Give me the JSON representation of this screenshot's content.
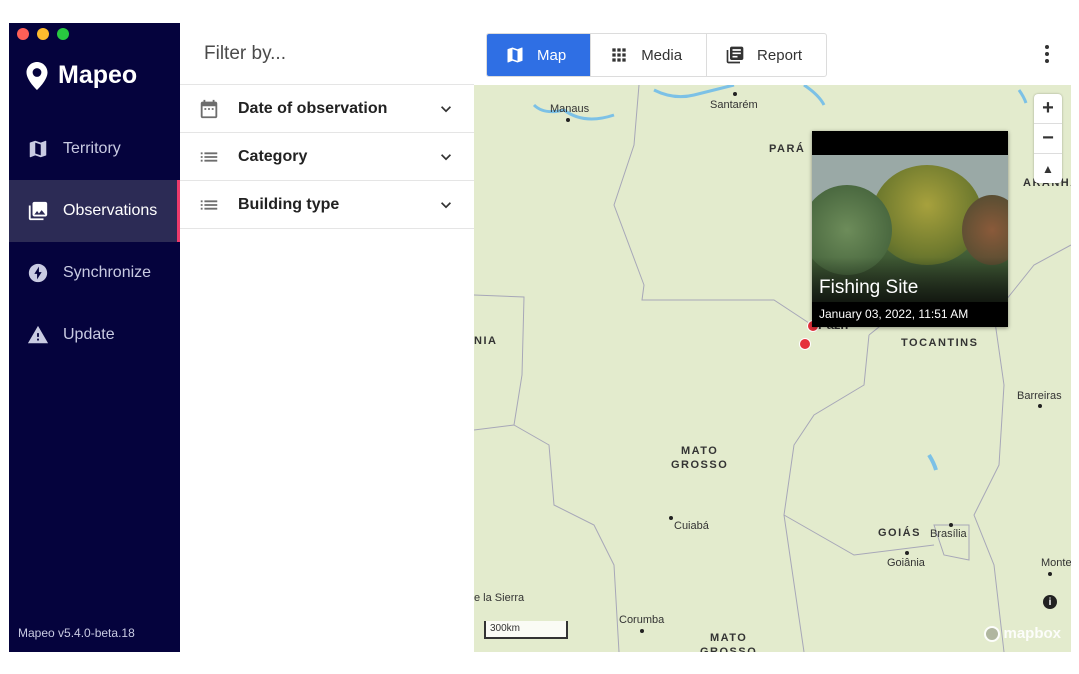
{
  "sidebar": {
    "app_name": "Mapeo",
    "items": [
      {
        "label": "Territory",
        "icon": "map-icon"
      },
      {
        "label": "Observations",
        "icon": "photo-library-icon"
      },
      {
        "label": "Synchronize",
        "icon": "bolt-icon"
      },
      {
        "label": "Update",
        "icon": "warning-icon"
      }
    ],
    "active_index": 1,
    "version": "Mapeo v5.4.0-beta.18"
  },
  "filters": {
    "title": "Filter by...",
    "items": [
      {
        "label": "Date of observation",
        "icon": "calendar-icon"
      },
      {
        "label": "Category",
        "icon": "list-icon"
      },
      {
        "label": "Building type",
        "icon": "list-icon"
      }
    ]
  },
  "toolbar": {
    "tabs": [
      {
        "label": "Map",
        "icon": "map-icon",
        "active": true
      },
      {
        "label": "Media",
        "icon": "grid-icon",
        "active": false
      },
      {
        "label": "Report",
        "icon": "report-icon",
        "active": false
      }
    ]
  },
  "map": {
    "places": {
      "manaus": "Manaus",
      "santarem": "Santarém",
      "barreiras": "Barreiras",
      "cuiaba": "Cuiabá",
      "goiania": "Goiânia",
      "brasilia": "Brasília",
      "monte": "Monte",
      "sierra": "e la Sierra",
      "corumba": "Corumba",
      "paulo_afonso_partial": "Pazn"
    },
    "regions": {
      "para": "PARÁ",
      "maranhao": "ARANHÃO",
      "nia": "NIA",
      "tocantins": "TOCANTINS",
      "mato_grosso": "MATO\nGROSSO",
      "goias": "GOIÁS",
      "mato_grosso_sul": "MATO\nGROSSO"
    },
    "zoom_in": "+",
    "zoom_out": "−",
    "compass": "▲",
    "scale": "300km",
    "attribution": "mapbox",
    "info": "i",
    "popup": {
      "title": "Fishing Site",
      "date": "January 03, 2022, 11:51 AM"
    },
    "colors": {
      "land": "#e3ebcd",
      "water": "#7cc1e6",
      "accent": "#2f6fe4",
      "observation": "#e5303b"
    }
  }
}
